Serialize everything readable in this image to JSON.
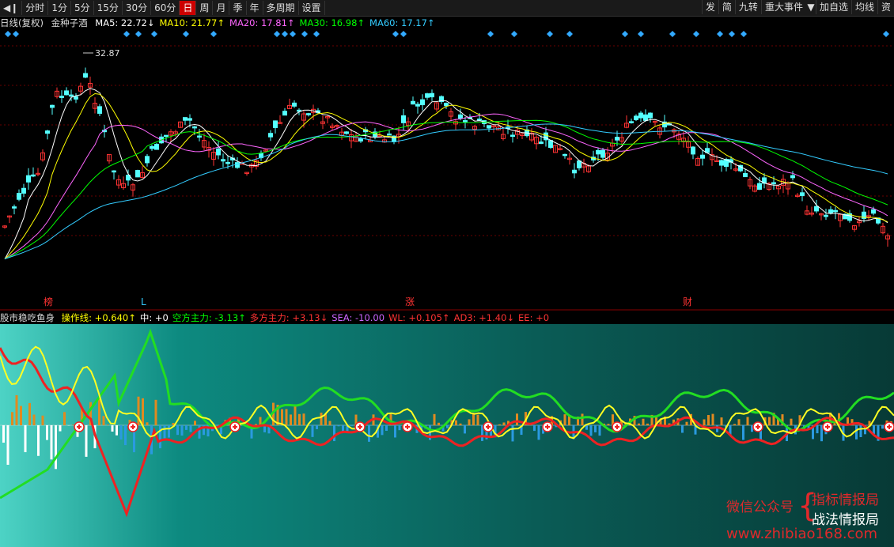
{
  "toolbar": {
    "back_icon": "play-back-icon",
    "periods": [
      "分时",
      "1分",
      "5分",
      "15分",
      "30分",
      "60分",
      "日",
      "周",
      "月",
      "季",
      "年",
      "多周期",
      "设置"
    ],
    "active_period": "日",
    "right_buttons": [
      "发",
      "简",
      "九转",
      "重大事件",
      "加自选",
      "均线",
      "资"
    ]
  },
  "info_bar": {
    "period_label": "日线(复权)",
    "stock_name": "金种子酒",
    "ma": [
      {
        "label": "MA5: 22.72↓",
        "color": "#ffffff"
      },
      {
        "label": "MA10: 21.77↑",
        "color": "#ffff00"
      },
      {
        "label": "MA20: 17.81↑",
        "color": "#ff66ff"
      },
      {
        "label": "MA30: 16.98↑",
        "color": "#00ff00"
      },
      {
        "label": "MA60: 17.17↑",
        "color": "#33ccff"
      }
    ]
  },
  "price_chart": {
    "max_label": "32.87",
    "markers": [
      "榜",
      "L",
      "涨",
      "财"
    ],
    "colors": {
      "up": "#ff3333",
      "down": "#54ffff",
      "grid": "#6a0000"
    }
  },
  "indicator_bar": {
    "name": "股市稳吃鱼身",
    "items": [
      {
        "label": "操作线: +0.640↑",
        "color": "#ffff00"
      },
      {
        "label": "中: +0",
        "color": "#ffffff"
      },
      {
        "label": "空方主力: -3.13↑",
        "color": "#00ff00"
      },
      {
        "label": "多方主力: +3.13↓",
        "color": "#ff3333"
      },
      {
        "label": "SEA: -10.00",
        "color": "#cc66ff"
      },
      {
        "label": "WL: +0.105↑",
        "color": "#ff3333"
      },
      {
        "label": "AD3: +1.40↓",
        "color": "#ff3333"
      },
      {
        "label": "EE: +0",
        "color": "#ff3333"
      }
    ]
  },
  "watermark": {
    "wechat": "微信公众号",
    "name1": "指标情报局",
    "name2": "战法情报局",
    "url": "www.zhibiao168.com"
  }
}
